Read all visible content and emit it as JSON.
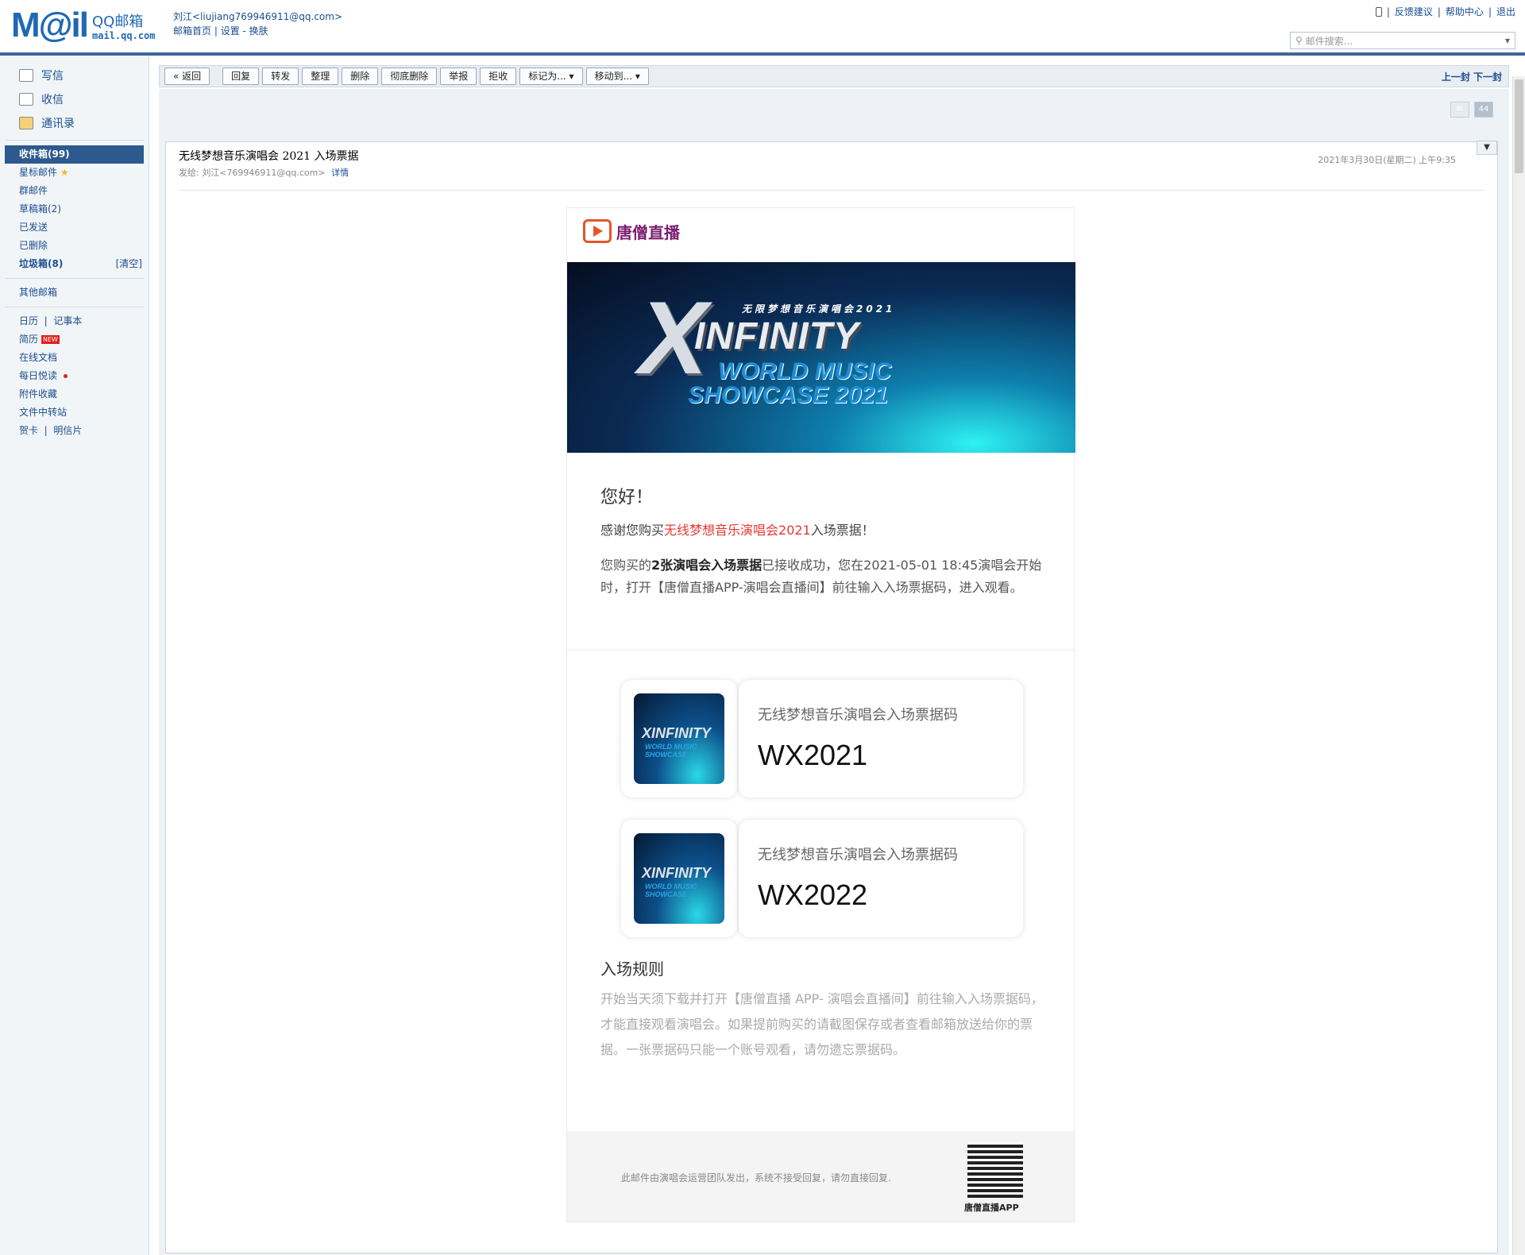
{
  "header": {
    "logo_mail": "M@il",
    "logo_qq": "QQ邮箱",
    "logo_domain": "mail.qq.com",
    "user": "刘江<liujiang769946911@qq.com>",
    "links": [
      "邮箱首页",
      "设置",
      "换肤"
    ],
    "top_links": [
      "反馈建议",
      "帮助中心",
      "退出"
    ],
    "search_placeholder": "邮件搜索..."
  },
  "sidebar": {
    "main": [
      "写信",
      "收信",
      "通讯录"
    ],
    "inbox": "收件箱(99)",
    "folders": [
      "星标邮件",
      "群邮件",
      "草稿箱(2)",
      "已发送",
      "已删除"
    ],
    "junk": "垃圾箱(8)",
    "junk_action": "[清空]",
    "other": "其他邮箱",
    "apps": [
      "日历",
      "记事本",
      "简历",
      "在线文档",
      "每日悦读",
      "附件收藏",
      "文件中转站",
      "贺卡",
      "明信片"
    ],
    "new_badge": "NEW"
  },
  "toolbar": {
    "buttons": [
      "« 返回",
      "回复",
      "转发",
      "整理",
      "删除",
      "彻底删除",
      "举报",
      "拒收",
      "标记为... ▾",
      "移动到... ▾"
    ],
    "nav": "上一封 下一封"
  },
  "mail": {
    "unread_count": "44",
    "subject": "无线梦想音乐演唱会 2021 入场票据",
    "from_label": "发给:",
    "from": "刘江<769946911@qq.com>",
    "details": "详情",
    "date": "2021年3月30日(星期二) 上午9:35"
  },
  "body": {
    "brand": "唐僧直播",
    "banner_line1": "无限梦想音乐演唱会2021",
    "banner_x": "X",
    "banner_line2": "INFINITY",
    "banner_line3": "WORLD MUSIC",
    "banner_line4": "SHOWCASE 2021",
    "hello": "您好！",
    "thanks_prefix": "感谢您购买",
    "thanks_event": "无线梦想音乐演唱会2021",
    "thanks_suffix": "入场票据！",
    "info_prefix": "您购买的",
    "info_bold": "2张演唱会入场票据",
    "info_suffix": "已接收成功，您在2021-05-01 18:45演唱会开始时，打开【唐僧直播APP-演唱会直播间】前往输入入场票据码，进入观看。",
    "tickets": [
      {
        "label": "无线梦想音乐演唱会入场票据码",
        "code": "WX2021"
      },
      {
        "label": "无线梦想音乐演唱会入场票据码",
        "code": "WX2022"
      }
    ],
    "rules_title": "入场规则",
    "rules_text": "开始当天须下载并打开【唐僧直播 APP- 演唱会直播间】前往输入入场票据码，才能直接观看演唱会。如果提前购买的请截图保存或者查看邮箱放送给你的票据。一张票据码只能一个账号观看，请勿遗忘票据码。",
    "footer_note": "此邮件由演唱会运营团队发出，系统不接受回复，请勿直接回复.",
    "qr_label": "唐僧直播APP"
  }
}
